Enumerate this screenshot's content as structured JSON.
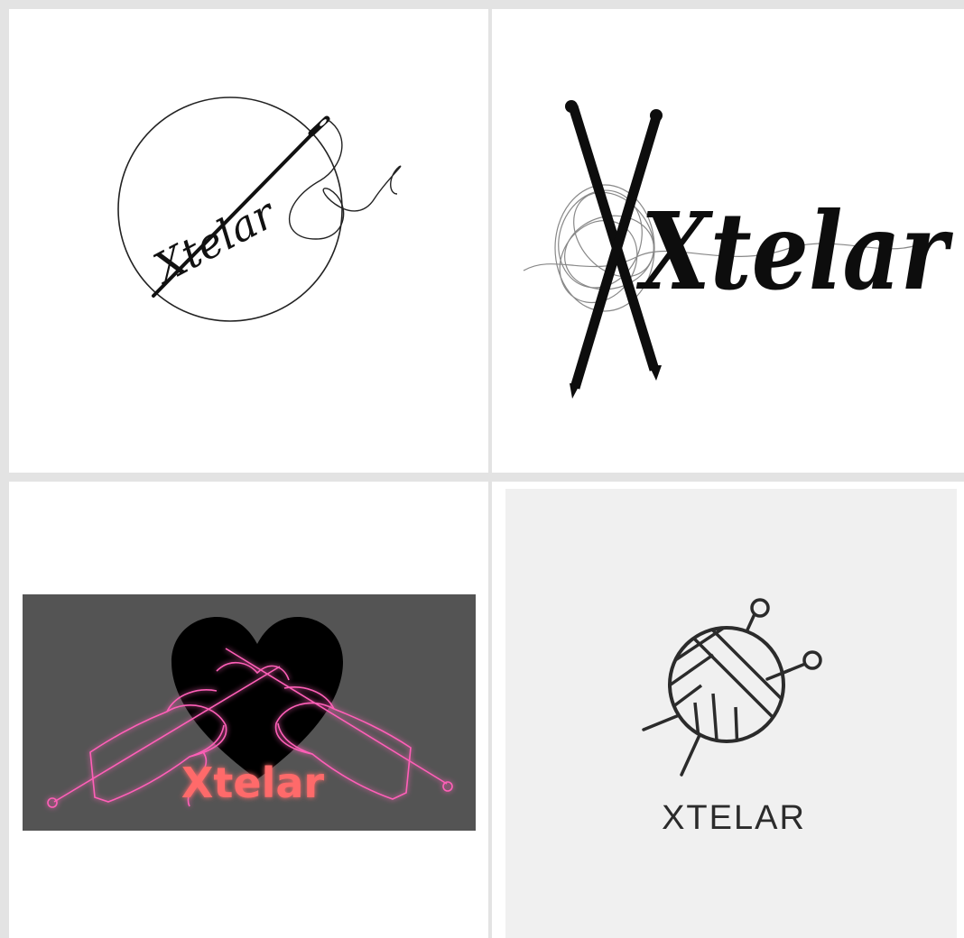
{
  "logos": [
    {
      "brand": "Xtelar",
      "icon": "needle-thread-icon"
    },
    {
      "brand": "Xtelar",
      "icon": "knitting-needles-yarn-icon"
    },
    {
      "brand": "Xtelar",
      "icon": "knitting-hands-heart-icon"
    },
    {
      "brand": "XTELAR",
      "icon": "yarn-ball-icon"
    }
  ],
  "colors": {
    "grid_gap": "#e3e3e3",
    "ink": "#111111",
    "neon_pink": "#ff5fb8",
    "neon_red": "#ff6666",
    "dark_panel": "#545454",
    "light_panel": "#f0f0f0",
    "yarn_ink": "#2b2b2b"
  }
}
